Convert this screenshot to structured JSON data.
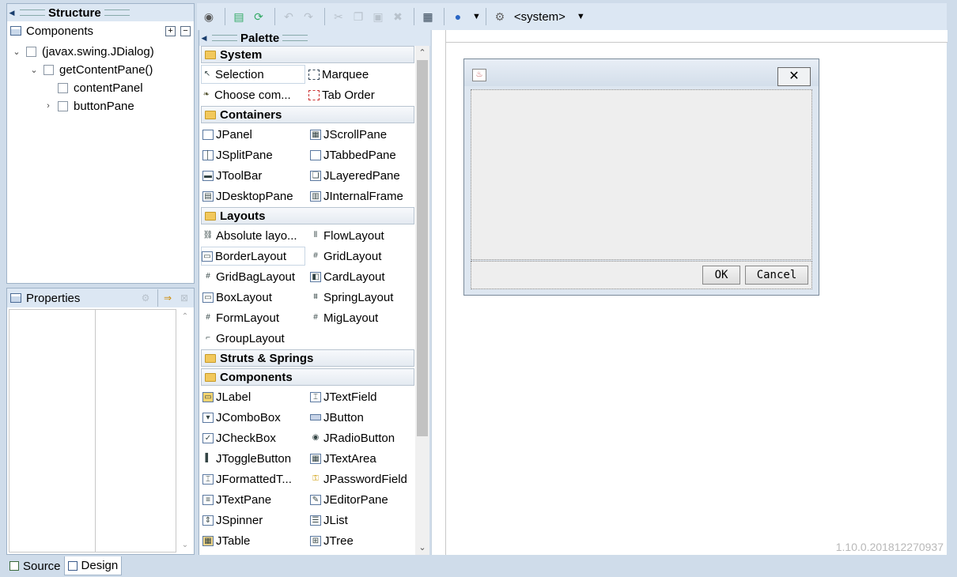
{
  "structure": {
    "title": "Structure",
    "components_label": "Components",
    "tree": [
      {
        "label": "(javax.swing.JDialog)",
        "expanded": true
      },
      {
        "label": "getContentPane()",
        "expanded": true
      },
      {
        "label": "contentPanel"
      },
      {
        "label": "buttonPane",
        "collapsed": true
      }
    ]
  },
  "properties": {
    "title": "Properties"
  },
  "toolbar": {
    "system_label": "<system>"
  },
  "palette": {
    "title": "Palette",
    "categories": {
      "system": "System",
      "containers": "Containers",
      "layouts": "Layouts",
      "struts": "Struts & Springs",
      "components": "Components"
    },
    "system_items": [
      "Selection",
      "Marquee",
      "Choose com...",
      "Tab Order"
    ],
    "containers_items": [
      "JPanel",
      "JScrollPane",
      "JSplitPane",
      "JTabbedPane",
      "JToolBar",
      "JLayeredPane",
      "JDesktopPane",
      "JInternalFrame"
    ],
    "layouts_items": [
      "Absolute layo...",
      "FlowLayout",
      "BorderLayout",
      "GridLayout",
      "GridBagLayout",
      "CardLayout",
      "BoxLayout",
      "SpringLayout",
      "FormLayout",
      "MigLayout",
      "GroupLayout"
    ],
    "components_items": [
      "JLabel",
      "JTextField",
      "JComboBox",
      "JButton",
      "JCheckBox",
      "JRadioButton",
      "JToggleButton",
      "JTextArea",
      "JFormattedT...",
      "JPasswordField",
      "JTextPane",
      "JEditorPane",
      "JSpinner",
      "JList",
      "JTable",
      "JTree"
    ]
  },
  "dialog": {
    "ok_label": "OK",
    "cancel_label": "Cancel"
  },
  "version": "1.10.0.201812270937",
  "bottom_tabs": [
    "Source",
    "Design"
  ]
}
